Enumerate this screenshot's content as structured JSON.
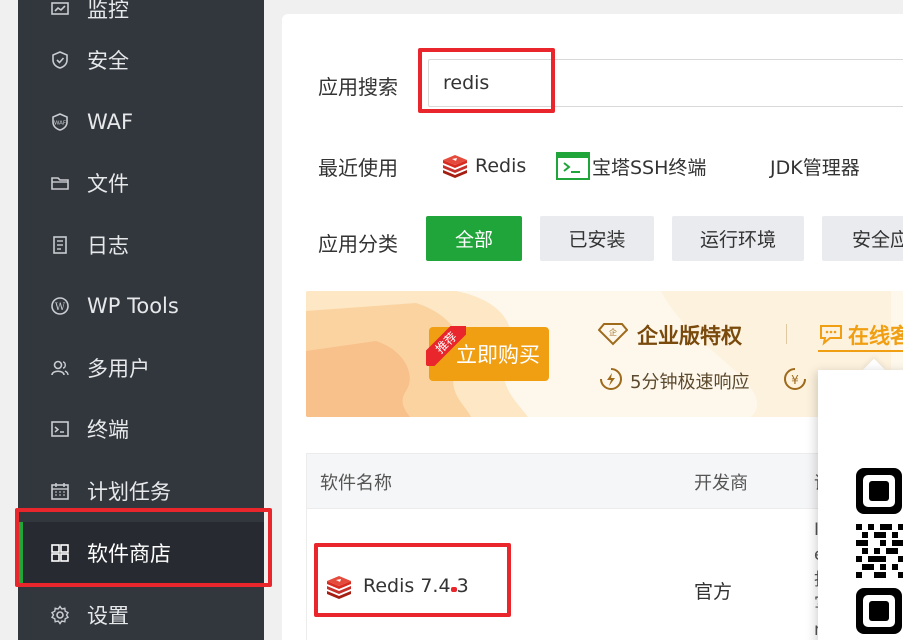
{
  "sidebar": {
    "items": [
      {
        "label": "监控",
        "icon": "monitor-icon"
      },
      {
        "label": "安全",
        "icon": "shield-icon"
      },
      {
        "label": "WAF",
        "icon": "waf-shield-icon"
      },
      {
        "label": "文件",
        "icon": "folder-icon"
      },
      {
        "label": "日志",
        "icon": "log-icon"
      },
      {
        "label": "WP Tools",
        "icon": "wordpress-icon"
      },
      {
        "label": "多用户",
        "icon": "users-icon"
      },
      {
        "label": "终端",
        "icon": "terminal-icon"
      },
      {
        "label": "计划任务",
        "icon": "calendar-icon"
      },
      {
        "label": "软件商店",
        "icon": "app-grid-icon",
        "active": true
      },
      {
        "label": "设置",
        "icon": "gear-icon"
      }
    ]
  },
  "search": {
    "label": "应用搜索",
    "value": "redis"
  },
  "recent": {
    "label": "最近使用",
    "items": [
      {
        "label": "Redis",
        "icon": "redis-icon"
      },
      {
        "label": "宝塔SSH终端",
        "icon": "ssh-terminal-icon"
      },
      {
        "label": "JDK管理器"
      }
    ]
  },
  "category": {
    "label": "应用分类",
    "buttons": [
      "全部",
      "已安装",
      "运行环境",
      "安全应"
    ]
  },
  "banner": {
    "recommend_tag": "推荐",
    "buy_label": "立即购买",
    "enterprise_title": "企业版特权",
    "response_text": "5分钟极速响应",
    "online_service": "在线客"
  },
  "table": {
    "headers": [
      "软件名称",
      "开发商"
    ],
    "rows": [
      {
        "name": "Redis 7.4.3",
        "developer": "官方",
        "desc_chars": [
          "I",
          "e",
          "找",
          "写",
          "n"
        ]
      }
    ]
  },
  "colors": {
    "sidebar_bg": "#32373e",
    "accent_green": "#20a53a",
    "highlight_red": "#e8262c",
    "banner_orange": "#f19f12"
  }
}
